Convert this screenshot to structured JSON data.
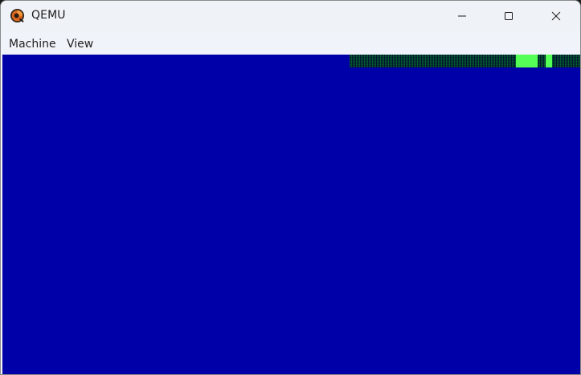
{
  "window": {
    "title": "QEMU",
    "icon": "qemu-logo-icon"
  },
  "controls": {
    "minimize_icon": "minimize-icon",
    "maximize_icon": "maximize-icon",
    "close_icon": "close-icon"
  },
  "menubar": {
    "items": [
      {
        "label": "Machine"
      },
      {
        "label": "View"
      }
    ]
  },
  "screen": {
    "background": "#0000A8",
    "status_dither_color": "#43C97A",
    "status_bright_color": "#55FF55"
  }
}
